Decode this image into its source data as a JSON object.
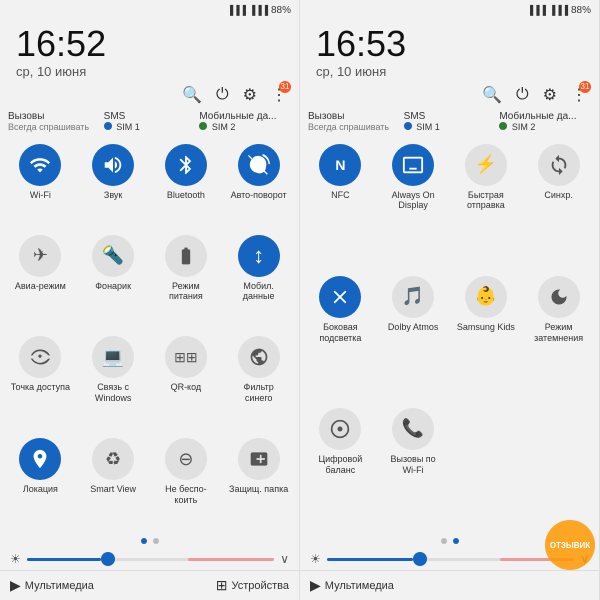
{
  "left": {
    "statusBar": {
      "signal1": "▐▐▐",
      "signal2": "▐▐▐",
      "battery": "88%"
    },
    "time": "16:52",
    "date": "ср, 10 июня",
    "headerIcons": {
      "search": "🔍",
      "power": "⏻",
      "settings": "⚙",
      "more": "⋮",
      "badgeCount": "31"
    },
    "simRow": {
      "calls": "Вызовы",
      "callsSub": "Всегда спрашивать",
      "sms": "SMS",
      "smsSim": "SIM 1",
      "data": "Мобильные да...",
      "dataSim": "SIM 2"
    },
    "tiles": [
      {
        "id": "wifi",
        "icon": "📶",
        "label": "Wi-Fi",
        "active": true,
        "unicode": ""
      },
      {
        "id": "sound",
        "icon": "🔊",
        "label": "Звук",
        "active": true,
        "unicode": ""
      },
      {
        "id": "bluetooth",
        "icon": "🔵",
        "label": "Bluetooth",
        "active": true,
        "unicode": ""
      },
      {
        "id": "rotate",
        "icon": "🔄",
        "label": "Авто-поворот",
        "active": true,
        "unicode": ""
      },
      {
        "id": "airplane",
        "icon": "✈",
        "label": "Авиа-режим",
        "active": false,
        "unicode": ""
      },
      {
        "id": "flashlight",
        "icon": "🔦",
        "label": "Фонарик",
        "active": false,
        "unicode": ""
      },
      {
        "id": "power-save",
        "icon": "🔋",
        "label": "Режим питания",
        "active": false,
        "unicode": ""
      },
      {
        "id": "mobile-data",
        "icon": "↕",
        "label": "Мобил. данные",
        "active": true,
        "unicode": ""
      },
      {
        "id": "hotspot",
        "icon": "📡",
        "label": "Точка доступа",
        "active": false,
        "unicode": ""
      },
      {
        "id": "windows",
        "icon": "💻",
        "label": "Связь с Windows",
        "active": false,
        "unicode": ""
      },
      {
        "id": "qr",
        "icon": "⊞",
        "label": "QR-код",
        "active": false,
        "unicode": ""
      },
      {
        "id": "blue-filter",
        "icon": "🔵",
        "label": "Фильтр синего",
        "active": false,
        "unicode": ""
      },
      {
        "id": "location",
        "icon": "📍",
        "label": "Локация",
        "active": true,
        "unicode": ""
      },
      {
        "id": "smart-view",
        "icon": "♻",
        "label": "Smart View",
        "active": false,
        "unicode": ""
      },
      {
        "id": "do-not-disturb",
        "icon": "🚫",
        "label": "Не беспо-коить",
        "active": false,
        "unicode": ""
      },
      {
        "id": "secure-folder",
        "icon": "🔒",
        "label": "Защищ. папка",
        "active": false,
        "unicode": ""
      }
    ],
    "dots": [
      true,
      false
    ],
    "brightness": {
      "thumbPos": "30%"
    },
    "bottomBar": {
      "media": "Мультимедиа",
      "devices": "Устройства"
    }
  },
  "right": {
    "statusBar": {
      "signal1": "▐▐▐",
      "signal2": "▐▐▐",
      "battery": "88%"
    },
    "time": "16:53",
    "date": "ср, 10 июня",
    "headerIcons": {
      "search": "🔍",
      "power": "⏻",
      "settings": "⚙",
      "more": "⋮",
      "badgeCount": "31"
    },
    "simRow": {
      "calls": "Вызовы",
      "callsSub": "Всегда спрашивать",
      "sms": "SMS",
      "smsSim": "SIM 1",
      "data": "Мобильные да...",
      "dataSim": "SIM 2"
    },
    "tiles": [
      {
        "id": "nfc",
        "icon": "N",
        "label": "NFC",
        "active": true,
        "unicode": "N"
      },
      {
        "id": "always-on",
        "icon": "⬛",
        "label": "Always On Display",
        "active": true,
        "unicode": ""
      },
      {
        "id": "fast-charge",
        "icon": "⚡",
        "label": "Быстрая отправка",
        "active": false,
        "unicode": ""
      },
      {
        "id": "sync",
        "icon": "🔄",
        "label": "Синхр.",
        "active": false,
        "unicode": ""
      },
      {
        "id": "side-light",
        "icon": "💡",
        "label": "Боковая подсветка",
        "active": true,
        "unicode": ""
      },
      {
        "id": "dolby",
        "icon": "🎵",
        "label": "Dolby Atmos",
        "active": false,
        "unicode": ""
      },
      {
        "id": "samsung-kids",
        "icon": "👶",
        "label": "Samsung Kids",
        "active": false,
        "unicode": ""
      },
      {
        "id": "night-mode",
        "icon": "🌙",
        "label": "Режим затемнения",
        "active": false,
        "unicode": ""
      },
      {
        "id": "digital-balance",
        "icon": "⊙",
        "label": "Цифровой баланс",
        "active": false,
        "unicode": ""
      },
      {
        "id": "wifi-call",
        "icon": "📞",
        "label": "Вызовы по Wi-Fi",
        "active": false,
        "unicode": ""
      }
    ],
    "dots": [
      false,
      true
    ],
    "brightness": {
      "thumbPos": "35%"
    },
    "bottomBar": {
      "media": "Мультимедиа"
    },
    "watermark": "ОТЗЫВИК"
  }
}
